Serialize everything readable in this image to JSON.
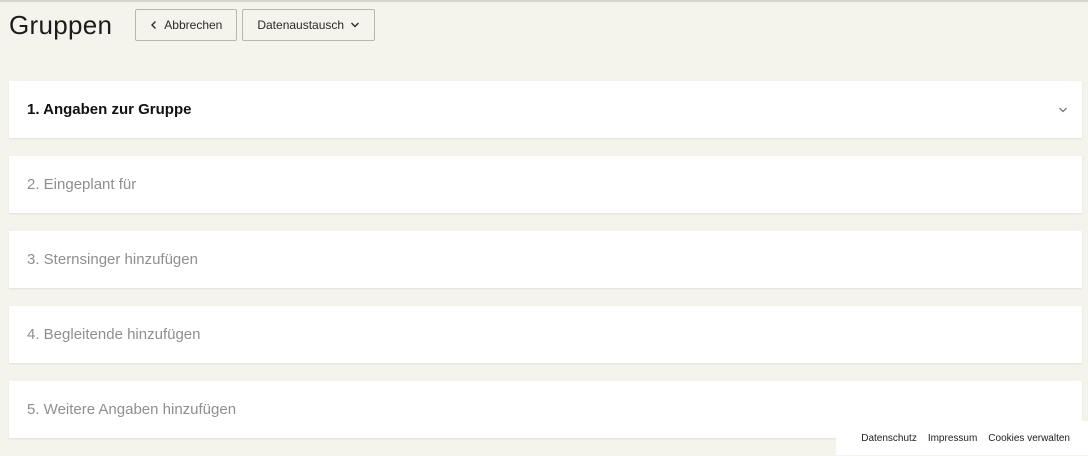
{
  "header": {
    "title": "Gruppen",
    "cancel_label": "Abbrechen",
    "exchange_label": "Datenaustausch"
  },
  "sections": [
    {
      "label": "1. Angaben zur Gruppe",
      "active": true
    },
    {
      "label": "2. Eingeplant für",
      "active": false
    },
    {
      "label": "3. Sternsinger hinzufügen",
      "active": false
    },
    {
      "label": "4. Begleitende hinzufügen",
      "active": false
    },
    {
      "label": "5. Weitere Angaben hinzufügen",
      "active": false
    }
  ],
  "footer": {
    "links": [
      "Datenschutz",
      "Impressum",
      "Cookies verwalten"
    ]
  },
  "icons": {
    "back": "chevron-left-icon",
    "dropdown": "chevron-down-icon",
    "expand": "chevron-down-icon"
  },
  "colors": {
    "background": "#f4f3ec",
    "card": "#ffffff",
    "active_text": "#111111",
    "inactive_text": "#8f8f8f"
  }
}
